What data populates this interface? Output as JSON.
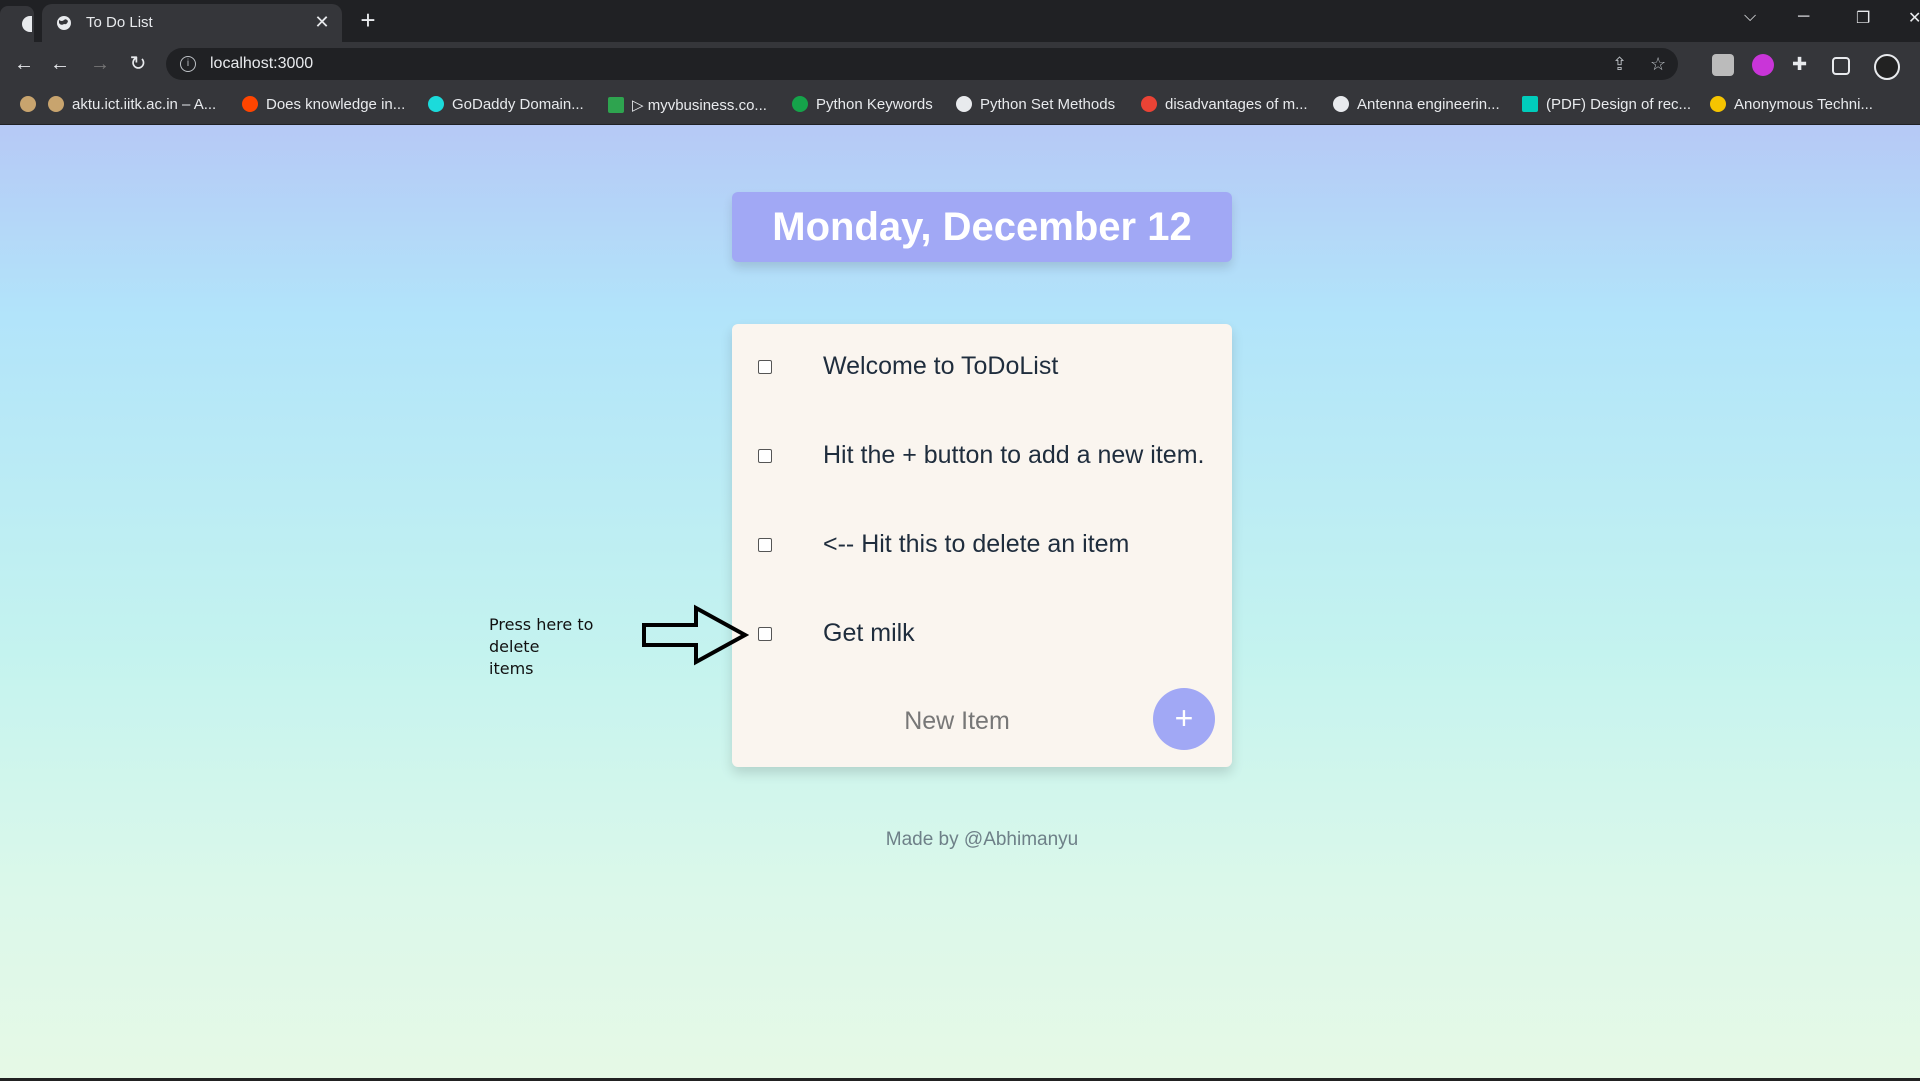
{
  "browser": {
    "tab_title": "To Do List",
    "url": "localhost:3000",
    "bookmarks": [
      {
        "label": "aktu.ict.iitk.ac.in – A...",
        "color": "#c8a46e"
      },
      {
        "label": "Does knowledge in...",
        "color": "#ff4500"
      },
      {
        "label": "GoDaddy Domain...",
        "color": "#1bdbdb"
      },
      {
        "label": "▷ myvbusiness.co...",
        "color": "#2ea44f"
      },
      {
        "label": "Python Keywords",
        "color": "#15a34a"
      },
      {
        "label": "Python Set Methods",
        "color": "#e8eaed"
      },
      {
        "label": "disadvantages of m...",
        "color": "#ea4335"
      },
      {
        "label": "Antenna engineerin...",
        "color": "#e8eaed"
      },
      {
        "label": "(PDF) Design of rec...",
        "color": "#00ccbb"
      },
      {
        "label": "Anonymous Techni...",
        "color": "#f5c400"
      }
    ]
  },
  "app": {
    "date": "Monday, December 12",
    "items": [
      {
        "label": "Welcome to ToDoList",
        "checked": false
      },
      {
        "label": "Hit the + button to add a new item.",
        "checked": false
      },
      {
        "label": "<-- Hit this to delete an item",
        "checked": false
      },
      {
        "label": "Get milk",
        "checked": false
      }
    ],
    "new_item_placeholder": "New Item",
    "add_button_label": "+",
    "footer": "Made by @Abhimanyu"
  },
  "annotation": {
    "line1": "Press here to delete",
    "line2": "items"
  },
  "colors": {
    "accent": "#a1a8f5",
    "card": "#faf5ef"
  }
}
